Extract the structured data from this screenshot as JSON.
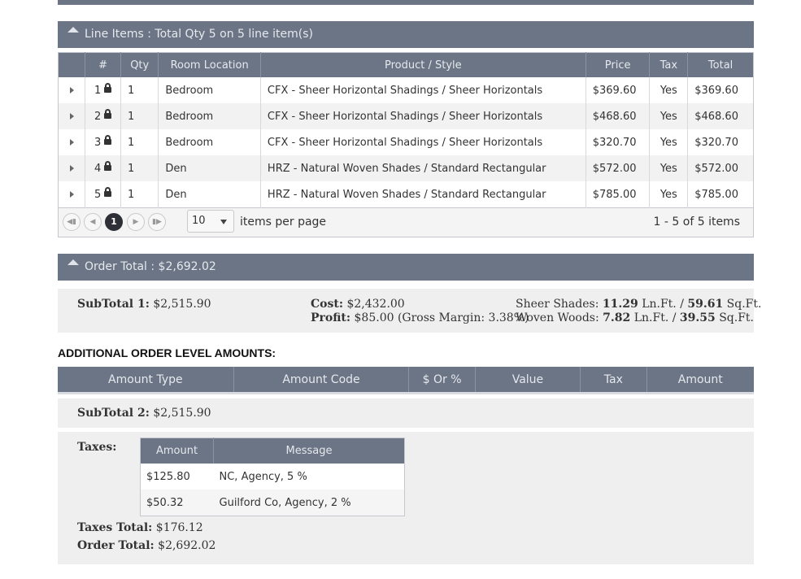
{
  "line_items": {
    "header": "Line Items : Total Qty 5 on 5 line item(s)",
    "columns": [
      "#",
      "Qty",
      "Room Location",
      "Product / Style",
      "Price",
      "Tax",
      "Total"
    ],
    "rows": [
      {
        "num": "1",
        "qty": "1",
        "room": "Bedroom",
        "product": "CFX - Sheer Horizontal Shadings / Sheer Horizontals",
        "price": "$369.60",
        "tax": "Yes",
        "total": "$369.60"
      },
      {
        "num": "2",
        "qty": "1",
        "room": "Bedroom",
        "product": "CFX - Sheer Horizontal Shadings / Sheer Horizontals",
        "price": "$468.60",
        "tax": "Yes",
        "total": "$468.60"
      },
      {
        "num": "3",
        "qty": "1",
        "room": "Bedroom",
        "product": "CFX - Sheer Horizontal Shadings / Sheer Horizontals",
        "price": "$320.70",
        "tax": "Yes",
        "total": "$320.70"
      },
      {
        "num": "4",
        "qty": "1",
        "room": "Den",
        "product": "HRZ - Natural Woven Shades / Standard Rectangular",
        "price": "$572.00",
        "tax": "Yes",
        "total": "$572.00"
      },
      {
        "num": "5",
        "qty": "1",
        "room": "Den",
        "product": "HRZ - Natural Woven Shades / Standard Rectangular",
        "price": "$785.00",
        "tax": "Yes",
        "total": "$785.00"
      }
    ],
    "pager": {
      "first_icon": "first-page-icon",
      "prev_icon": "prev-page-icon",
      "current_page": "1",
      "next_icon": "next-page-icon",
      "last_icon": "last-page-icon",
      "page_size": "10",
      "page_size_label": "items per page",
      "info": "1 - 5 of 5 items"
    }
  },
  "order_total": {
    "header": "Order Total : $2,692.02",
    "subtotal1_label": "SubTotal 1:",
    "subtotal1_value": "$2,515.90",
    "cost_label": "Cost:",
    "cost_value": "$2,432.00",
    "profit_label": "Profit:",
    "profit_value": "$85.00 (Gross Margin: 3.38%)",
    "sheer_label": "Sheer Shades:",
    "sheer_ln": "11.29",
    "sheer_ln_unit": "Ln.Ft. /",
    "sheer_sq": "59.61",
    "sheer_sq_unit": "Sq.Ft.",
    "woven_label": "Woven Woods:",
    "woven_ln": "7.82",
    "woven_ln_unit": "Ln.Ft. /",
    "woven_sq": "39.55",
    "woven_sq_unit": "Sq.Ft."
  },
  "additional": {
    "title": "ADDITIONAL ORDER LEVEL AMOUNTS:",
    "columns": [
      "Amount Type",
      "Amount Code",
      "$ Or %",
      "Value",
      "Tax",
      "Amount"
    ],
    "subtotal2_label": "SubTotal 2:",
    "subtotal2_value": "$2,515.90"
  },
  "taxes": {
    "label": "Taxes:",
    "columns": [
      "Amount",
      "Message"
    ],
    "rows": [
      {
        "amount": "$125.80",
        "message": "NC, Agency, 5 %"
      },
      {
        "amount": "$50.32",
        "message": "Guilford Co, Agency, 2 %"
      }
    ],
    "total_label": "Taxes Total:",
    "total_value": "$176.12",
    "order_total_label": "Order Total:",
    "order_total_value": "$2,692.02"
  }
}
